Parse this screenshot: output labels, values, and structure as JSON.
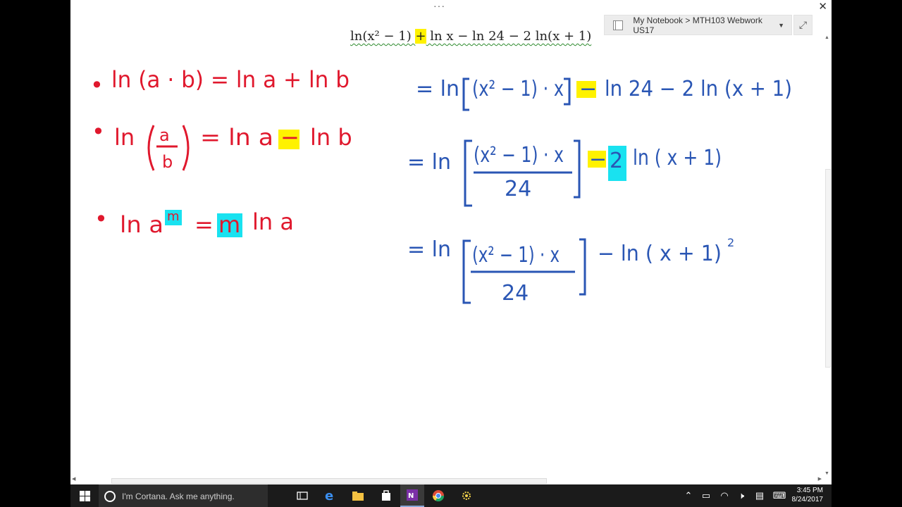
{
  "window": {
    "dots": "···",
    "close": "✕",
    "breadcrumb": "My Notebook > MTH103 Webwork US17",
    "expand": "⤢"
  },
  "typed_equation": {
    "a": "ln(x² − 1) ",
    "plus": "+",
    "b": " ln x − ln 24 − 2 ln(x + 1)"
  },
  "notes": {
    "rules": [
      {
        "bullet": "•",
        "text": "ln (a · b) = ln a + ln b"
      },
      {
        "bullet": "•",
        "num": "a",
        "den": "b",
        "lhs": "ln",
        "rhs_a": "= ln a",
        "minus": "−",
        "rhs_b": "ln b"
      },
      {
        "bullet": "•",
        "lhs": "ln a",
        "sup": "m",
        "eq": "=",
        "m": "m",
        "rhs": "ln a"
      }
    ],
    "steps": [
      {
        "eq": "= ln",
        "bracket": "(x² − 1) · x",
        "minus": "−",
        "rest": "ln 24 − 2 ln (x + 1)"
      },
      {
        "eq": "= ln",
        "num": "(x² − 1) · x",
        "den": "24",
        "minus": "−",
        "coef": "2",
        "rest": "ln ( x + 1)"
      },
      {
        "eq": "= ln",
        "num": "(x² − 1) · x",
        "den": "24",
        "rest": "−  ln ( x + 1)",
        "sup": "2"
      }
    ]
  },
  "taskbar": {
    "cortana_placeholder": "I'm Cortana. Ask me anything.",
    "time": "3:45 PM",
    "date": "8/24/2017",
    "icons": [
      "windows-start-icon",
      "task-view-icon",
      "edge-icon",
      "file-explorer-icon",
      "store-icon",
      "onenote-icon",
      "chrome-icon",
      "settings-gear-icon"
    ]
  },
  "colors": {
    "ink_red": "#e0182d",
    "ink_blue": "#2a56b4",
    "highlight_yellow": "#fff200",
    "highlight_cyan": "#19e2f0"
  }
}
